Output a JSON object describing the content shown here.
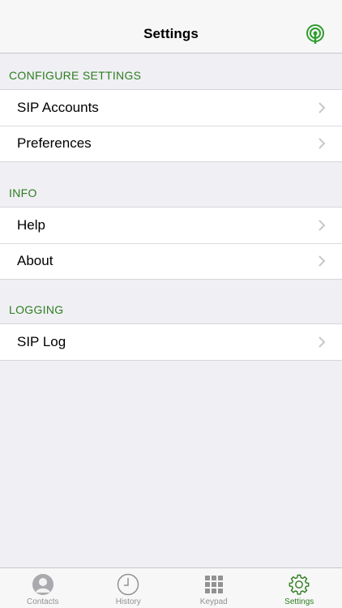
{
  "nav": {
    "title": "Settings",
    "status_icon": "antenna-signal-icon"
  },
  "sections": [
    {
      "header": "CONFIGURE SETTINGS",
      "rows": [
        {
          "label": "SIP Accounts"
        },
        {
          "label": "Preferences"
        }
      ]
    },
    {
      "header": "INFO",
      "rows": [
        {
          "label": "Help"
        },
        {
          "label": "About"
        }
      ]
    },
    {
      "header": "LOGGING",
      "rows": [
        {
          "label": "SIP Log"
        }
      ]
    }
  ],
  "tabs": [
    {
      "label": "Contacts",
      "icon": "person-icon",
      "active": false
    },
    {
      "label": "History",
      "icon": "clock-icon",
      "active": false
    },
    {
      "label": "Keypad",
      "icon": "keypad-icon",
      "active": false
    },
    {
      "label": "Settings",
      "icon": "gear-icon",
      "active": true
    }
  ],
  "colors": {
    "accent": "#2e7d1f",
    "background": "#efeff4",
    "inactive_tab": "#929292"
  }
}
